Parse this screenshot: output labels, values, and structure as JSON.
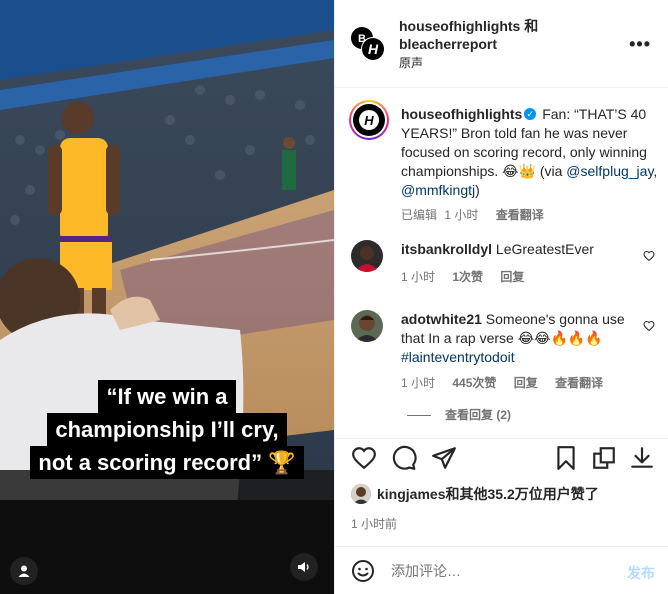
{
  "video": {
    "caption_lines": [
      "“If we win a",
      "championship I’ll cry,",
      "not a scoring record” 🏆"
    ]
  },
  "header": {
    "authors_line1": "houseofhighlights 和",
    "authors_line2": "bleacherreport",
    "audio": "原声",
    "more": "•••"
  },
  "post": {
    "username": "houseofhighlights",
    "caption_text": "Fan: “THAT’S 40 YEARS!” Bron told fan he was never focused on scoring record, only winning championships. 😂👑 (via ",
    "mention1": "@selfplug_jay",
    "sep": ", ",
    "mention2": "@mmfkingtj",
    "close": ")",
    "edited": "已编辑",
    "time": "1 小时",
    "see_translation": "查看翻译"
  },
  "comments": [
    {
      "username": "itsbankrolldyl",
      "text": "LeGreatestEver",
      "time": "1 小时",
      "likes": "1次赞",
      "reply": "回复"
    },
    {
      "username": "adotwhite21",
      "text": "Someone's gonna use that In a rap verse 😂😂🔥🔥🔥 ",
      "hashtag": "#lainteventrytodoit",
      "time": "1 小时",
      "likes": "445次赞",
      "reply": "回复",
      "translate": "查看翻译"
    }
  ],
  "view_replies": "查看回复 (2)",
  "likes_line": {
    "user": "kingjames",
    "rest": "和其他35.2万位用户赞了"
  },
  "posted_ago": "1 小时前",
  "comment_box": {
    "placeholder": "添加评论…",
    "post_label": "发布"
  },
  "colors": {
    "accent": "#0095f6",
    "mention": "#00376b",
    "muted": "#737373",
    "court_blue": "#1b4e8c",
    "lakers_purple": "#552583",
    "lakers_gold": "#fdb927"
  }
}
